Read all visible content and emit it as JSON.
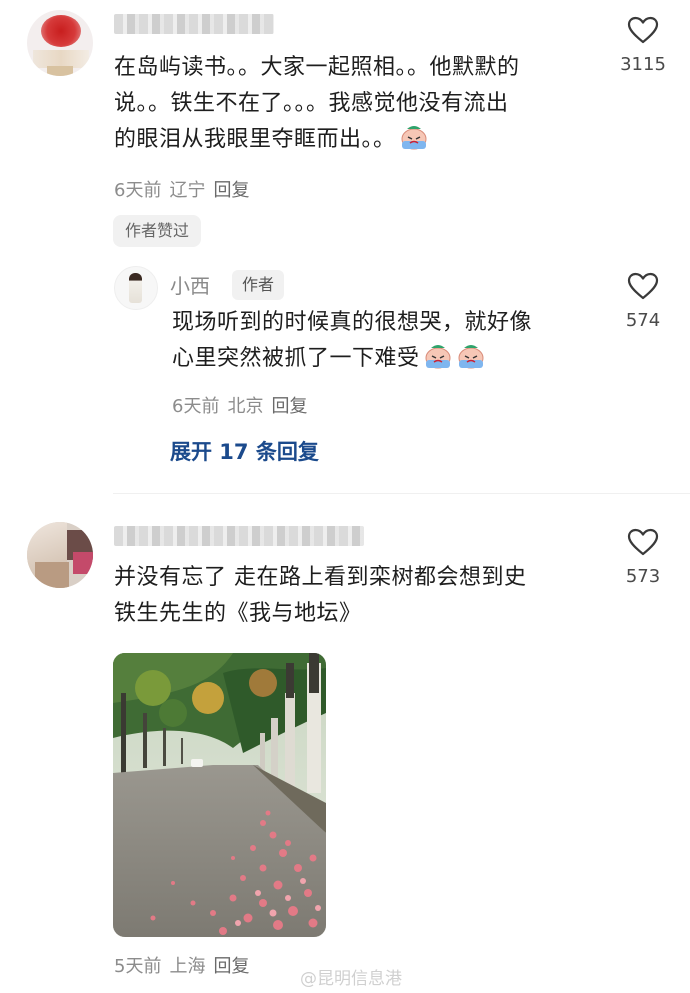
{
  "comments": [
    {
      "text_lines": [
        "在岛屿读书。。大家一起照相。。他默默的",
        "说。。铁生不在了。。。我感觉他没有流出",
        "的眼泪从我眼里夺眶而出。。"
      ],
      "meta": {
        "time": "6天前",
        "location": "辽宁",
        "reply": "回复"
      },
      "badge": "作者赞过",
      "like_count": "3115"
    },
    {
      "reply_name": "小西",
      "author_tag": "作者",
      "text_lines": [
        "现场听到的时候真的很想哭，就好像",
        "心里突然被抓了一下难受"
      ],
      "meta": {
        "time": "6天前",
        "location": "北京",
        "reply": "回复"
      },
      "like_count": "574"
    },
    {
      "text_lines": [
        "并没有忘了 走在路上看到栾树都会想到史",
        "铁生先生的《我与地坛》"
      ],
      "meta": {
        "time": "5天前",
        "location": "上海",
        "reply": "回复"
      },
      "like_count": "573"
    }
  ],
  "expand_replies": "展开 17 条回复",
  "watermark": "@昆明信息港",
  "icons": {
    "like": "heart-outline-icon",
    "emoji": "crying-emoji-icon"
  },
  "colors": {
    "link": "#1b4a8c",
    "meta": "#8c8c8c"
  }
}
